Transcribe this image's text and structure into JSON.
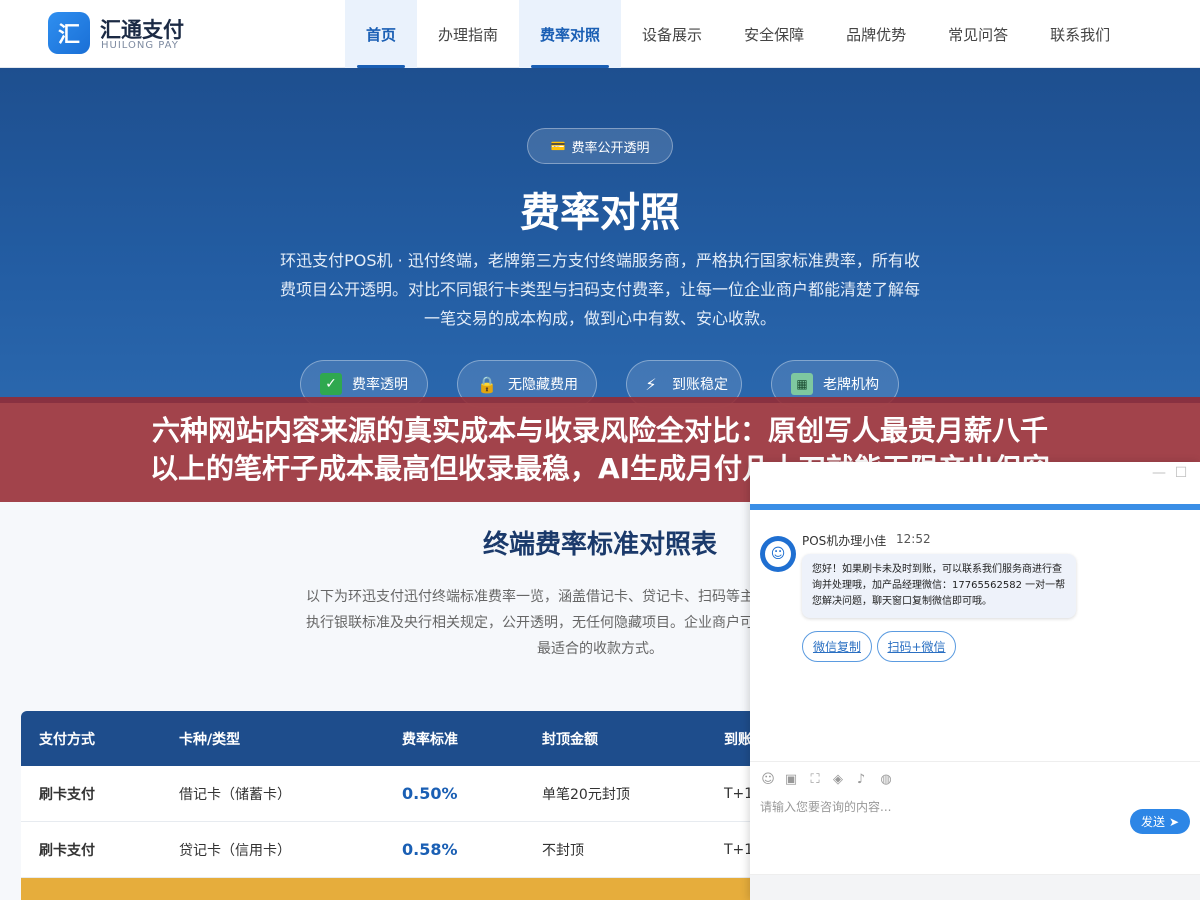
{
  "header": {
    "logo_char": "汇",
    "logo_name": "汇通支付",
    "logo_sub": "HUILONG PAY",
    "nav": [
      {
        "label": "首页",
        "active": true
      },
      {
        "label": "办理指南",
        "active": false
      },
      {
        "label": "费率对照",
        "active": true
      },
      {
        "label": "设备展示",
        "active": false
      },
      {
        "label": "安全保障",
        "active": false
      },
      {
        "label": "品牌优势",
        "active": false
      },
      {
        "label": "常见问答",
        "active": false
      },
      {
        "label": "联系我们",
        "active": false
      }
    ]
  },
  "hero": {
    "badge": "费率公开透明",
    "title": "费率对照",
    "description": "环迅支付POS机 · 迅付终端，老牌第三方支付终端服务商，严格执行国家标准费率，所有收费项目公开透明。对比不同银行卡类型与扫码支付费率，让每一位企业商户都能清楚了解每一笔交易的成本构成，做到心中有数、安心收款。",
    "features": [
      {
        "label": "费率透明",
        "icon": "check-icon"
      },
      {
        "label": "无隐藏费用",
        "icon": "lock-icon"
      },
      {
        "label": "到账稳定",
        "icon": "bolt-icon"
      },
      {
        "label": "老牌机构",
        "icon": "building-icon"
      }
    ]
  },
  "banner": {
    "line1": "六种网站内容来源的真实成本与收录风险全对比：原创写人最贵月薪八千",
    "line2": "以上的笔杆子成本最高但收录最稳，AI生成月付几十刀就能无限产出但容"
  },
  "section": {
    "title": "终端费率标准对照表",
    "description": "以下为环迅支付迅付终端标准费率一览，涵盖借记卡、贷记卡、扫码等主流支付方式。费率严格执行银联标准及央行相关规定，公开透明，无任何隐藏项目。企业商户可根据自身经营情况选择最适合的收款方式。"
  },
  "table": {
    "headers": [
      "支付方式",
      "卡种/类型",
      "费率标准",
      "封顶金额",
      "到账"
    ],
    "rows": [
      [
        "刷卡支付",
        "借记卡（储蓄卡）",
        "0.50%",
        "单笔20元封顶",
        "T+1"
      ],
      [
        "刷卡支付",
        "贷记卡（信用卡）",
        "0.58%",
        "不封顶",
        "T+1"
      ]
    ]
  },
  "chat": {
    "agent_name": "POS机办理小佳",
    "time": "12:52",
    "message": "您好！如果刷卡未及时到账，可以联系我们服务商进行查询并处理哦，加产品经理微信：17765562582 一对一帮您解决问题，聊天窗口复制微信即可哦。",
    "quick_buttons": [
      "微信复制",
      "扫码+微信"
    ],
    "input_placeholder": "请输入您要咨询的内容...",
    "send_label": "发送",
    "tools": [
      "emoji-icon",
      "image-icon",
      "crop-icon",
      "shield-icon",
      "audio-icon",
      "wechat-icon"
    ]
  },
  "colors": {
    "primary": "#1e4d8c",
    "accent": "#1a5fb4",
    "banner": "#962a32",
    "gold": "#e6ad3c"
  }
}
